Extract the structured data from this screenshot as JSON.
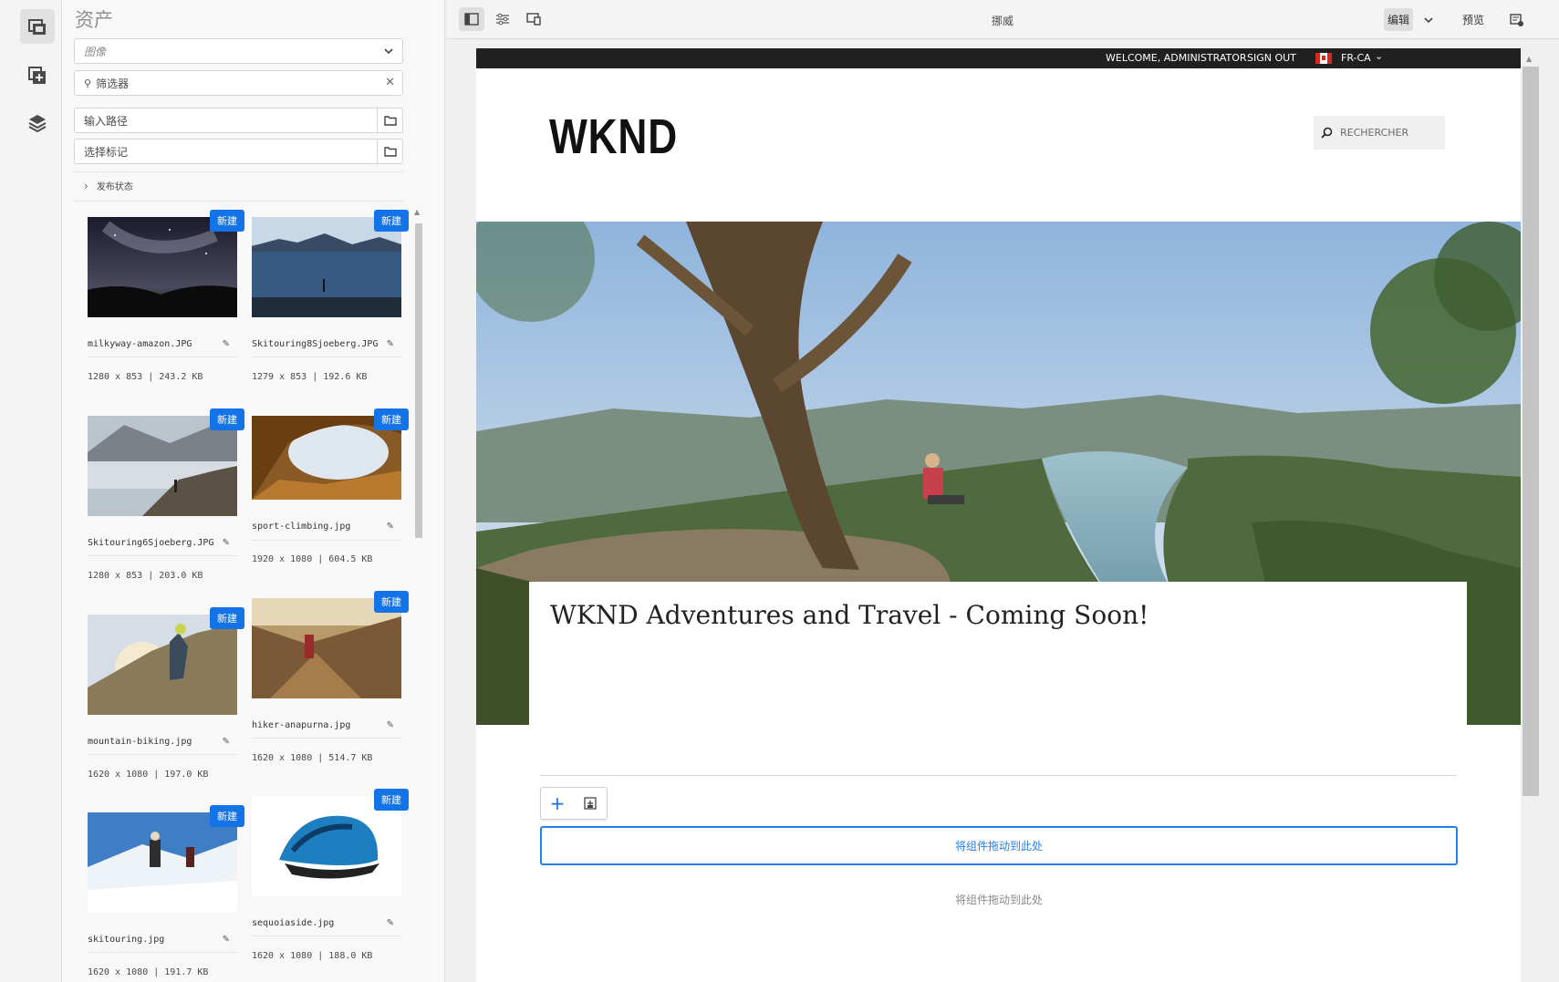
{
  "rail": {
    "items": [
      "assets-icon",
      "components-icon",
      "content-tree-icon"
    ]
  },
  "panel": {
    "title": "资产",
    "asset_type": "图像",
    "filter_placeholder": "筛选器",
    "path_placeholder": "输入路径",
    "tags_placeholder": "选择标记",
    "publish_status": "发布状态",
    "badge_label": "新建",
    "assets": [
      {
        "name": "milkyway-amazon.JPG",
        "meta": "1280 x 853 | 243.2 KB"
      },
      {
        "name": "Skitouring8Sjoeberg.JPG",
        "meta": "1279 x 853 | 192.6 KB"
      },
      {
        "name": "Skitouring6Sjoeberg.JPG",
        "meta": "1280 x 853 | 203.0 KB"
      },
      {
        "name": "sport-climbing.jpg",
        "meta": "1920 x 1080 | 604.5 KB"
      },
      {
        "name": "mountain-biking.jpg",
        "meta": "1620 x 1080 | 197.0 KB"
      },
      {
        "name": "hiker-anapurna.jpg",
        "meta": "1620 x 1080 | 514.7 KB"
      },
      {
        "name": "skitouring.jpg",
        "meta": "1620 x 1080 | 191.7 KB"
      },
      {
        "name": "sequoiaside.jpg",
        "meta": "1620 x 1080 | 188.0 KB"
      }
    ]
  },
  "toolbar": {
    "page_title": "挪威",
    "edit_label": "编辑",
    "preview_label": "预览"
  },
  "site": {
    "welcome": "WELCOME, ADMINISTRATOR",
    "signout": "SIGN OUT",
    "language": "FR-CA",
    "logo": "WKND",
    "search_placeholder": "RECHERCHER",
    "hero_title": "WKND Adventures and Travel - Coming Soon!",
    "drop_zone_label": "将组件拖动到此处",
    "drop_zone_label_2": "将组件拖动到此处"
  },
  "colors": {
    "accent": "#1473e6",
    "drop_border": "#2680eb",
    "site_topbar": "#202020"
  }
}
